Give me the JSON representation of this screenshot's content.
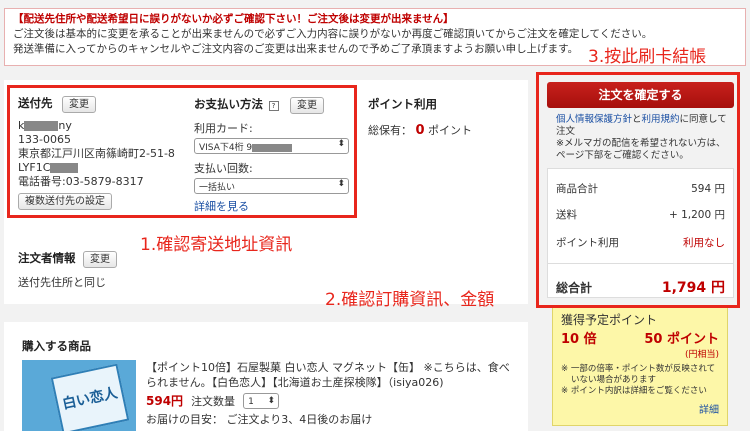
{
  "notice": {
    "warning": "【配送先住所や配送希望日に誤りがないか必ずご確認下さい！ご注文後は変更が出来ません】",
    "line1": "ご注文後は基本的に変更を承ることが出来ませんので必ずご入力内容に誤りがないか再度ご確認頂いてからご注文を確定してください。",
    "line2": "発送準備に入ってからのキャンセルやご注文内容のご変更は出来ませんので予めご了承頂ますようお願い申し上げます。"
  },
  "annotations": {
    "step1": "1.確認寄送地址資訊",
    "step2": "2.確認訂購資訊、金額",
    "step3": "3.按此刷卡結帳"
  },
  "shipping": {
    "title": "送付先",
    "change": "変更",
    "name_start": "k",
    "name_end": "ny",
    "zip": "133-0065",
    "address": "東京都江戸川区南篠崎町2-51-8",
    "building": "LYF1C",
    "phone": "電話番号:03-5879-8317",
    "multi_button": "複数送付先の設定"
  },
  "payment": {
    "title": "お支払い方法",
    "help_icon": "?",
    "change": "変更",
    "card_label": "利用カード:",
    "card_value": "VISA下4桁 9",
    "times_label": "支払い回数:",
    "times_value": "一括払い",
    "detail_link": "詳細を見る"
  },
  "points_use": {
    "title": "ポイント利用",
    "label": "総保有：",
    "value": "0",
    "unit": "ポイント"
  },
  "orderer": {
    "title": "注文者情報",
    "change": "変更",
    "text": "送付先住所と同じ"
  },
  "order": {
    "confirm_button": "注文を確定する",
    "agree_link1": "個人情報保護方針",
    "agree_and": "と",
    "agree_link2": "利用規約",
    "agree_tail": "に同意して",
    "agree_line2": "注文",
    "mailmag_line1": "※メルマガの配信を希望されない方は、",
    "mailmag_line2": "ページ下部をご確認ください。",
    "subtotal_label": "商品合計",
    "subtotal_value": "594 円",
    "shipping_label": "送料",
    "shipping_value": "+ 1,200 円",
    "points_label": "ポイント利用",
    "points_value": "利用なし",
    "total_label": "総合計",
    "total_value": "1,794 円"
  },
  "reward": {
    "title": "獲得予定ポイント",
    "rate": "10 倍",
    "points": "50 ポイント",
    "points_sub": "(円相当)",
    "note1": "※ 一部の倍率・ポイント数が反映されて",
    "note1b": "いない場合があります",
    "note2": "※ ポイント内訳は詳細をご覧ください",
    "detail": "詳細"
  },
  "items": {
    "title": "購入する商品",
    "name_line1": "【ポイント10倍】石屋製菓 白い恋人 マグネット【缶】 ※こちらは、食べ",
    "name_line2": "られません。【白色恋人】【北海道お土産探検隊】（isiya026)",
    "price": "594円",
    "qty_label": "注文数量",
    "qty_value": "1",
    "delivery": "お届けの目安： ご注文より3、4日後のお届け",
    "product_image_text": "白い恋人"
  },
  "colors": {
    "accent_red": "#bf0000",
    "annotation_red": "#e8261c",
    "link_blue": "#1a4fa3",
    "points_yellow": "#fdf7a8"
  }
}
